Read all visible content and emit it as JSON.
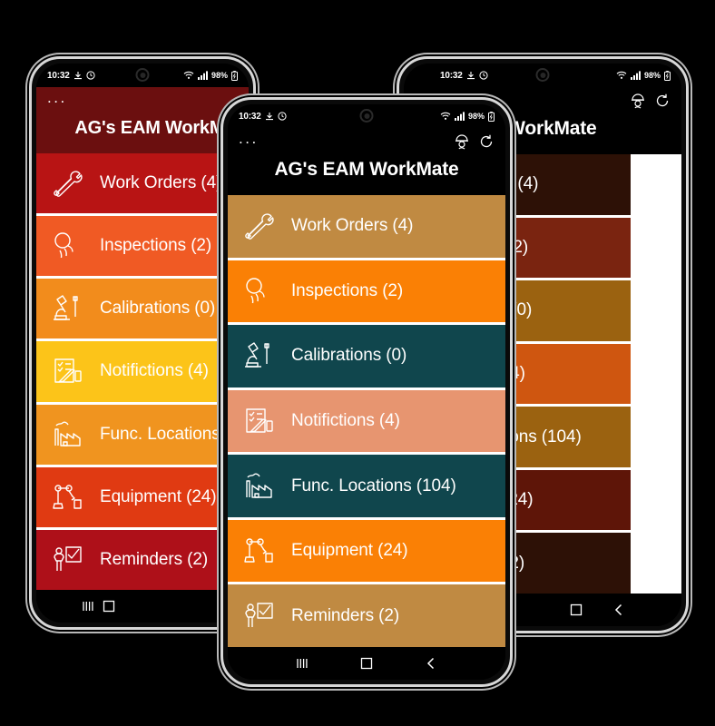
{
  "app": {
    "title": "AG's EAM WorkMate",
    "overflow_label": "...",
    "header_icons": [
      {
        "name": "worker-helmet-icon",
        "label": "Worker"
      },
      {
        "name": "sync-refresh-icon",
        "label": "Sync"
      }
    ]
  },
  "status_bar": {
    "time": "10:32",
    "left_icons": [
      "download-icon",
      "clock-icon"
    ],
    "right_icons": [
      "wifi-icon",
      "cellular-signal-icon"
    ],
    "battery_percent": "98%",
    "battery_icon": "battery-icon"
  },
  "nav_bar": {
    "recents_label": "Recents",
    "home_label": "Home",
    "back_label": "Back"
  },
  "menu_items": [
    {
      "id": "work-orders",
      "label": "Work Orders (4)",
      "name": "Work Orders",
      "count": 4,
      "icon": "wrench-screwdriver-icon"
    },
    {
      "id": "inspections",
      "label": "Inspections (2)",
      "name": "Inspections",
      "count": 2,
      "icon": "magnifier-inspect-icon"
    },
    {
      "id": "calibrations",
      "label": "Calibrations (0)",
      "name": "Calibrations",
      "count": 0,
      "icon": "microscope-icon"
    },
    {
      "id": "notifictions",
      "label": "Notifictions (4)",
      "name": "Notifictions",
      "count": 4,
      "icon": "clipboard-pen-icon"
    },
    {
      "id": "func-locations",
      "label": "Func. Locations (104)",
      "name": "Func. Locations",
      "count": 104,
      "icon": "factory-icon"
    },
    {
      "id": "equipment",
      "label": "Equipment (24)",
      "name": "Equipment",
      "count": 24,
      "icon": "robot-arm-icon"
    },
    {
      "id": "reminders",
      "label": "Reminders (2)",
      "name": "Reminders",
      "count": 2,
      "icon": "person-checklist-icon"
    }
  ],
  "themes": {
    "left": {
      "name": "Red theme",
      "header_bg": "#6b0f0f",
      "item_colors": [
        "#b81414",
        "#f05a24",
        "#f28c1c",
        "#fcc419",
        "#f0941f",
        "#e03a12",
        "#ae1019"
      ]
    },
    "center": {
      "name": "Default theme",
      "header_bg": "#000000",
      "item_colors": [
        "#c08a42",
        "#fa8005",
        "#10464d",
        "#e79570",
        "#10464d",
        "#fa8005",
        "#c08a42"
      ]
    },
    "right": {
      "name": "Dark brown theme",
      "header_bg": "#000000",
      "item_colors": [
        "#2d1106",
        "#7a2410",
        "#9b6210",
        "#cf5610",
        "#9b6210",
        "#5e1508",
        "#2d1106"
      ]
    }
  },
  "phone_labels": {
    "left": "phone-left-red-theme",
    "center": "phone-center-default-theme",
    "right": "phone-right-dark-theme"
  }
}
